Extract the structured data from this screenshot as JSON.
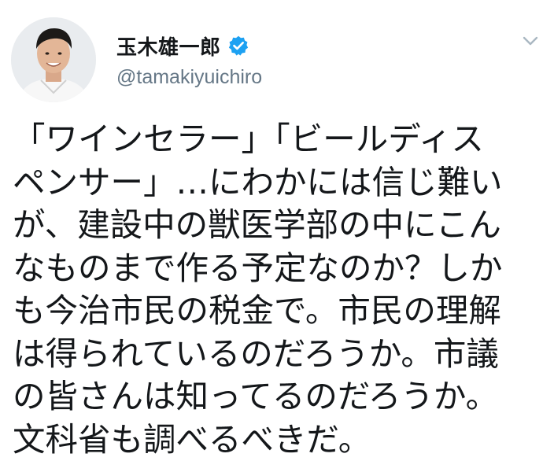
{
  "user": {
    "display_name": "玉木雄一郎",
    "handle": "@tamakiyuichiro",
    "verified": true
  },
  "tweet": {
    "lines": [
      "「ワインセラー」「ビールディス",
      "ペンサー」…にわかには信じ難い",
      "が、建設中の獣医学部の中にこん",
      "なものまで作る予定なのか？しか",
      "も今治市民の税金で。市民の理解",
      "は得られているのだろうか。市議",
      "の皆さんは知ってるのだろうか。",
      "文科省も調べるべきだ。"
    ]
  },
  "colors": {
    "verified_badge": "#1da1f2",
    "handle_text": "#657786",
    "body_text": "#14171a",
    "chevron": "#aab8c2"
  },
  "icons": {
    "verified": "verified-badge-icon",
    "menu": "chevron-down-icon"
  }
}
